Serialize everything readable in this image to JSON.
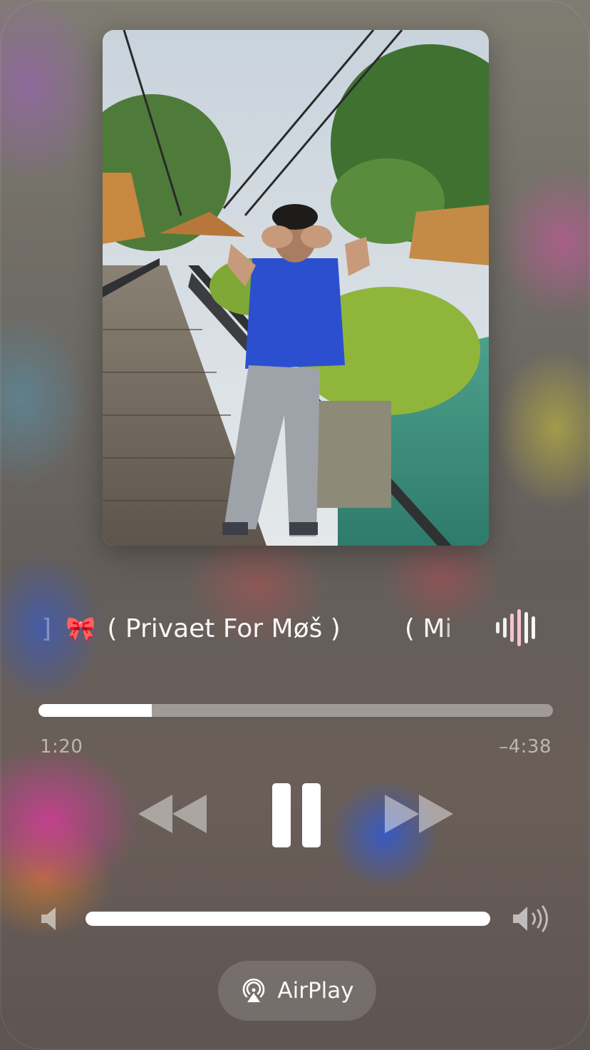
{
  "now_playing": {
    "title_lead": "]",
    "title_emoji": "🎀",
    "title": "( Privaet For Møš )",
    "title_next": "( Mi",
    "elapsed": "1:20",
    "remaining": "–4:38",
    "progress": 0.22
  },
  "controls": {
    "rewind_icon": "rewind-icon",
    "pause_icon": "pause-icon",
    "forward_icon": "fast-forward-icon",
    "playback_state": "playing"
  },
  "volume": {
    "level": 1.0,
    "low_icon": "speaker-low-icon",
    "high_icon": "speaker-high-icon"
  },
  "airplay": {
    "label": "AirPlay",
    "icon": "airplay-icon"
  },
  "colors": {
    "foreground": "#ffffff",
    "track": "rgba(255,255,255,0.38)",
    "bow_pink": "#f2a3bd"
  }
}
